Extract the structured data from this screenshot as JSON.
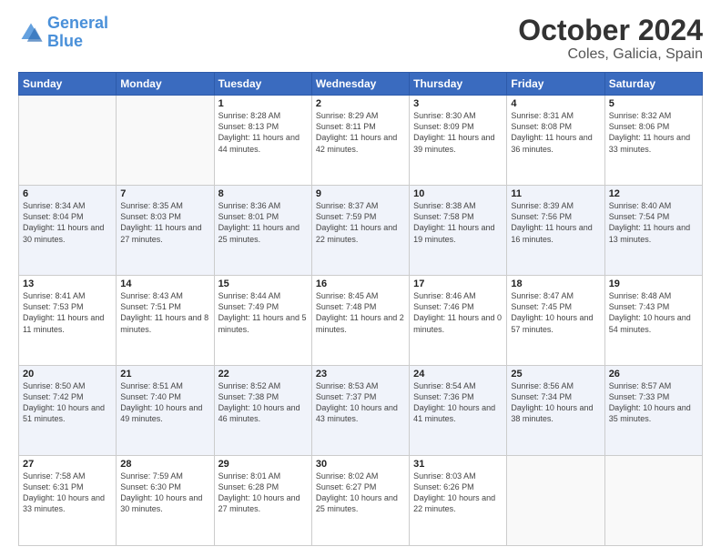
{
  "header": {
    "logo_line1": "General",
    "logo_line2": "Blue",
    "main_title": "October 2024",
    "subtitle": "Coles, Galicia, Spain"
  },
  "calendar": {
    "days_of_week": [
      "Sunday",
      "Monday",
      "Tuesday",
      "Wednesday",
      "Thursday",
      "Friday",
      "Saturday"
    ],
    "weeks": [
      [
        {
          "day": "",
          "info": ""
        },
        {
          "day": "",
          "info": ""
        },
        {
          "day": "1",
          "info": "Sunrise: 8:28 AM\nSunset: 8:13 PM\nDaylight: 11 hours and 44 minutes."
        },
        {
          "day": "2",
          "info": "Sunrise: 8:29 AM\nSunset: 8:11 PM\nDaylight: 11 hours and 42 minutes."
        },
        {
          "day": "3",
          "info": "Sunrise: 8:30 AM\nSunset: 8:09 PM\nDaylight: 11 hours and 39 minutes."
        },
        {
          "day": "4",
          "info": "Sunrise: 8:31 AM\nSunset: 8:08 PM\nDaylight: 11 hours and 36 minutes."
        },
        {
          "day": "5",
          "info": "Sunrise: 8:32 AM\nSunset: 8:06 PM\nDaylight: 11 hours and 33 minutes."
        }
      ],
      [
        {
          "day": "6",
          "info": "Sunrise: 8:34 AM\nSunset: 8:04 PM\nDaylight: 11 hours and 30 minutes."
        },
        {
          "day": "7",
          "info": "Sunrise: 8:35 AM\nSunset: 8:03 PM\nDaylight: 11 hours and 27 minutes."
        },
        {
          "day": "8",
          "info": "Sunrise: 8:36 AM\nSunset: 8:01 PM\nDaylight: 11 hours and 25 minutes."
        },
        {
          "day": "9",
          "info": "Sunrise: 8:37 AM\nSunset: 7:59 PM\nDaylight: 11 hours and 22 minutes."
        },
        {
          "day": "10",
          "info": "Sunrise: 8:38 AM\nSunset: 7:58 PM\nDaylight: 11 hours and 19 minutes."
        },
        {
          "day": "11",
          "info": "Sunrise: 8:39 AM\nSunset: 7:56 PM\nDaylight: 11 hours and 16 minutes."
        },
        {
          "day": "12",
          "info": "Sunrise: 8:40 AM\nSunset: 7:54 PM\nDaylight: 11 hours and 13 minutes."
        }
      ],
      [
        {
          "day": "13",
          "info": "Sunrise: 8:41 AM\nSunset: 7:53 PM\nDaylight: 11 hours and 11 minutes."
        },
        {
          "day": "14",
          "info": "Sunrise: 8:43 AM\nSunset: 7:51 PM\nDaylight: 11 hours and 8 minutes."
        },
        {
          "day": "15",
          "info": "Sunrise: 8:44 AM\nSunset: 7:49 PM\nDaylight: 11 hours and 5 minutes."
        },
        {
          "day": "16",
          "info": "Sunrise: 8:45 AM\nSunset: 7:48 PM\nDaylight: 11 hours and 2 minutes."
        },
        {
          "day": "17",
          "info": "Sunrise: 8:46 AM\nSunset: 7:46 PM\nDaylight: 11 hours and 0 minutes."
        },
        {
          "day": "18",
          "info": "Sunrise: 8:47 AM\nSunset: 7:45 PM\nDaylight: 10 hours and 57 minutes."
        },
        {
          "day": "19",
          "info": "Sunrise: 8:48 AM\nSunset: 7:43 PM\nDaylight: 10 hours and 54 minutes."
        }
      ],
      [
        {
          "day": "20",
          "info": "Sunrise: 8:50 AM\nSunset: 7:42 PM\nDaylight: 10 hours and 51 minutes."
        },
        {
          "day": "21",
          "info": "Sunrise: 8:51 AM\nSunset: 7:40 PM\nDaylight: 10 hours and 49 minutes."
        },
        {
          "day": "22",
          "info": "Sunrise: 8:52 AM\nSunset: 7:38 PM\nDaylight: 10 hours and 46 minutes."
        },
        {
          "day": "23",
          "info": "Sunrise: 8:53 AM\nSunset: 7:37 PM\nDaylight: 10 hours and 43 minutes."
        },
        {
          "day": "24",
          "info": "Sunrise: 8:54 AM\nSunset: 7:36 PM\nDaylight: 10 hours and 41 minutes."
        },
        {
          "day": "25",
          "info": "Sunrise: 8:56 AM\nSunset: 7:34 PM\nDaylight: 10 hours and 38 minutes."
        },
        {
          "day": "26",
          "info": "Sunrise: 8:57 AM\nSunset: 7:33 PM\nDaylight: 10 hours and 35 minutes."
        }
      ],
      [
        {
          "day": "27",
          "info": "Sunrise: 7:58 AM\nSunset: 6:31 PM\nDaylight: 10 hours and 33 minutes."
        },
        {
          "day": "28",
          "info": "Sunrise: 7:59 AM\nSunset: 6:30 PM\nDaylight: 10 hours and 30 minutes."
        },
        {
          "day": "29",
          "info": "Sunrise: 8:01 AM\nSunset: 6:28 PM\nDaylight: 10 hours and 27 minutes."
        },
        {
          "day": "30",
          "info": "Sunrise: 8:02 AM\nSunset: 6:27 PM\nDaylight: 10 hours and 25 minutes."
        },
        {
          "day": "31",
          "info": "Sunrise: 8:03 AM\nSunset: 6:26 PM\nDaylight: 10 hours and 22 minutes."
        },
        {
          "day": "",
          "info": ""
        },
        {
          "day": "",
          "info": ""
        }
      ]
    ]
  }
}
